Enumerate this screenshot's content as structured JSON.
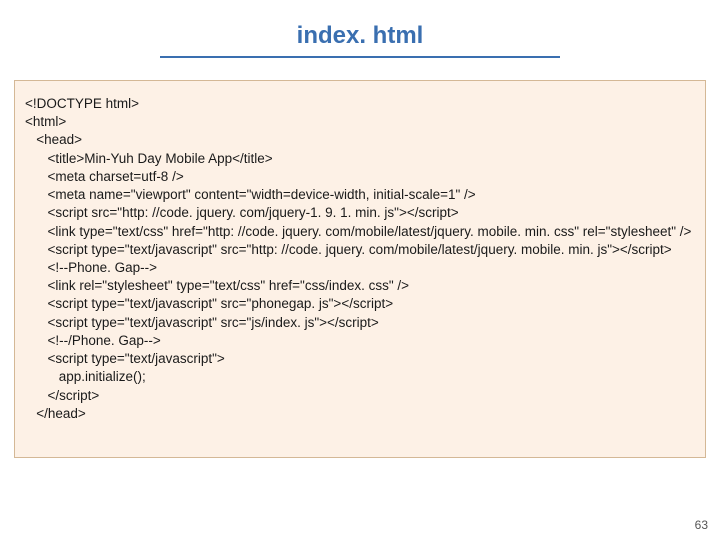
{
  "title": "index. html",
  "code_lines": [
    "<!DOCTYPE html>",
    "<html>",
    "   <head>",
    "      <title>Min-Yuh Day Mobile App</title>",
    "      <meta charset=utf-8 />",
    "      <meta name=\"viewport\" content=\"width=device-width, initial-scale=1\" />",
    "      <script src=\"http: //code. jquery. com/jquery-1. 9. 1. min. js\"></script>",
    "      <link type=\"text/css\" href=\"http: //code. jquery. com/mobile/latest/jquery. mobile. min. css\" rel=\"stylesheet\" />",
    "      <script type=\"text/javascript\" src=\"http: //code. jquery. com/mobile/latest/jquery. mobile. min. js\"></script>",
    "      <!--Phone. Gap-->",
    "      <link rel=\"stylesheet\" type=\"text/css\" href=\"css/index. css\" />",
    "      <script type=\"text/javascript\" src=\"phonegap. js\"></script>",
    "      <script type=\"text/javascript\" src=\"js/index. js\"></script>",
    "      <!--/Phone. Gap-->",
    "      <script type=\"text/javascript\">",
    "         app.initialize();",
    "      </script>",
    "   </head>"
  ],
  "page_number": "63"
}
